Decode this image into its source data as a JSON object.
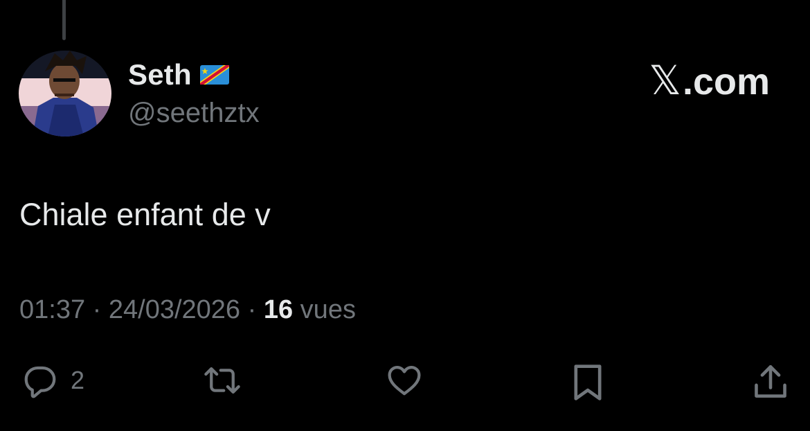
{
  "tweet": {
    "author": {
      "display_name": "Seth",
      "flag_icon": "flag-dr-congo-icon",
      "handle": "@seethztx"
    },
    "watermark": {
      "logo_icon": "x-logo-icon",
      "logo_glyph": "𝕏",
      "text": ".com"
    },
    "text": "Chiale enfant de v",
    "meta": {
      "time": "01:37",
      "separator": " · ",
      "date": "24/03/2026",
      "views_count": "16",
      "views_label": " vues"
    },
    "actions": {
      "reply_icon": "reply-icon",
      "reply_count": "2",
      "retweet_icon": "retweet-icon",
      "like_icon": "heart-icon",
      "bookmark_icon": "bookmark-icon",
      "share_icon": "share-icon"
    }
  },
  "colors": {
    "background": "#000000",
    "primary_text": "#e7e9ea",
    "secondary_text": "#71767b",
    "thread_line": "#3e4144",
    "flag_blue": "#2a8fd8",
    "flag_red": "#d21034",
    "flag_yellow": "#f7d618"
  }
}
